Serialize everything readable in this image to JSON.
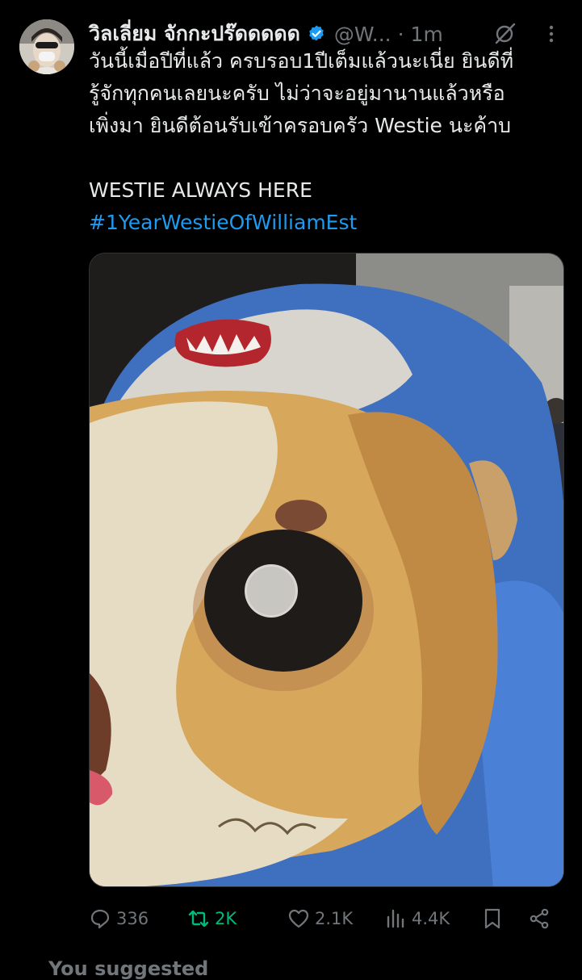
{
  "author": {
    "display_name": "วิลเลี่ยม จักกะปร๊ดดดดด",
    "handle": "@W...",
    "separator": "·",
    "time": "1m"
  },
  "tweet": {
    "lines": [
      "วันนี้เมื่อปีที่แล้ว ครบรอบ1ปีเต็มแล้วนะเนี่ย ยินดีที่",
      "รู้จักทุกคนเลยนะครับ ไม่ว่าจะอยู่มานานแล้วหรือ",
      "เพิ่งมา ยินดีต้อนรับเข้าครอบครัว Westie นะค้าบ"
    ],
    "tagline": "WESTIE ALWAYS HERE",
    "hashtag": "#1YearWestieOfWilliamEst"
  },
  "icons": {
    "verified": "verified-badge-icon",
    "grok": "grok-icon",
    "more": "more-options-icon",
    "reply": "reply-icon",
    "retweet": "retweet-icon",
    "like": "like-icon",
    "views": "views-icon",
    "bookmark": "bookmark-icon",
    "share": "share-icon"
  },
  "actions": {
    "replies": "336",
    "retweets": "2K",
    "likes": "2.1K",
    "views": "4.4K"
  },
  "next_row_partial": "You suggested",
  "colors": {
    "background": "#000000",
    "text": "#e7e9ea",
    "muted": "#71767b",
    "link": "#1d9bf0",
    "retweet_active": "#00ba7c",
    "verified": "#1d9bf0"
  }
}
